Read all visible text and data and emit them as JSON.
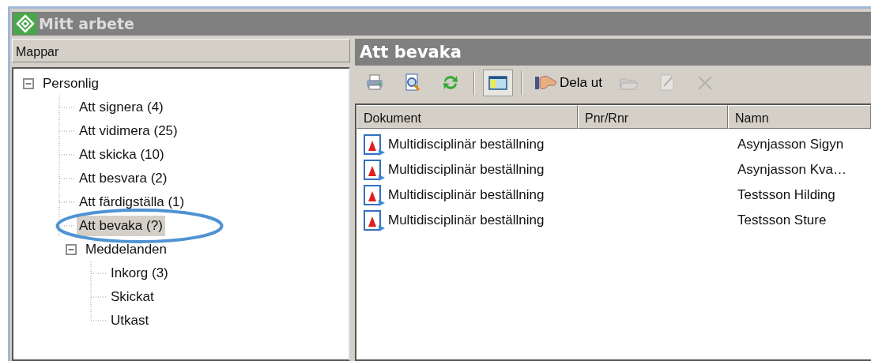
{
  "window": {
    "title": "Mitt arbete"
  },
  "folders": {
    "title": "Mappar",
    "tree": [
      {
        "label": "Personlig",
        "expanded": true,
        "children": [
          {
            "label": "Att signera (4)",
            "selected": false,
            "circled": false
          },
          {
            "label": "Att vidimera (25)",
            "selected": false,
            "circled": false
          },
          {
            "label": "Att skicka (10)",
            "selected": false,
            "circled": false
          },
          {
            "label": "Att besvara (2)",
            "selected": false,
            "circled": false
          },
          {
            "label": "Att färdigställa (1)",
            "selected": false,
            "circled": false
          },
          {
            "label": "Att bevaka (?)",
            "selected": true,
            "circled": true
          },
          {
            "label": "Meddelanden",
            "expanded": true,
            "children": [
              {
                "label": "Inkorg (3)",
                "selected": false,
                "circled": false
              },
              {
                "label": "Skickat",
                "selected": false,
                "circled": false
              },
              {
                "label": "Utkast",
                "selected": false,
                "circled": false
              }
            ]
          }
        ]
      }
    ]
  },
  "content": {
    "title": "Att bevaka",
    "toolbar": [
      {
        "kind": "icon",
        "disabled": false,
        "pressed": false
      },
      {
        "kind": "icon",
        "disabled": false,
        "pressed": false
      },
      {
        "kind": "icon",
        "disabled": false,
        "pressed": false
      },
      {
        "kind": "separator"
      },
      {
        "kind": "icon",
        "disabled": false,
        "pressed": true
      },
      {
        "kind": "separator"
      },
      {
        "kind": "labeled",
        "label": "Dela ut",
        "disabled": false,
        "pressed": false
      },
      {
        "kind": "icon",
        "disabled": true,
        "pressed": false
      },
      {
        "kind": "icon",
        "disabled": true,
        "pressed": false
      },
      {
        "kind": "icon",
        "disabled": true,
        "pressed": false
      }
    ],
    "table": {
      "columns": [
        "Dokument",
        "Pnr/Rnr",
        "Namn"
      ],
      "rows": [
        {
          "document": "Multidisciplinär beställning",
          "name": "Asynjasson Sigyn"
        },
        {
          "document": "Multidisciplinär beställning",
          "name": "Asynjasson Kva…"
        },
        {
          "document": "Multidisciplinär beställning",
          "name": "Testsson Hilding"
        },
        {
          "document": "Multidisciplinär beställning",
          "name": "Testsson Sture"
        }
      ]
    }
  }
}
